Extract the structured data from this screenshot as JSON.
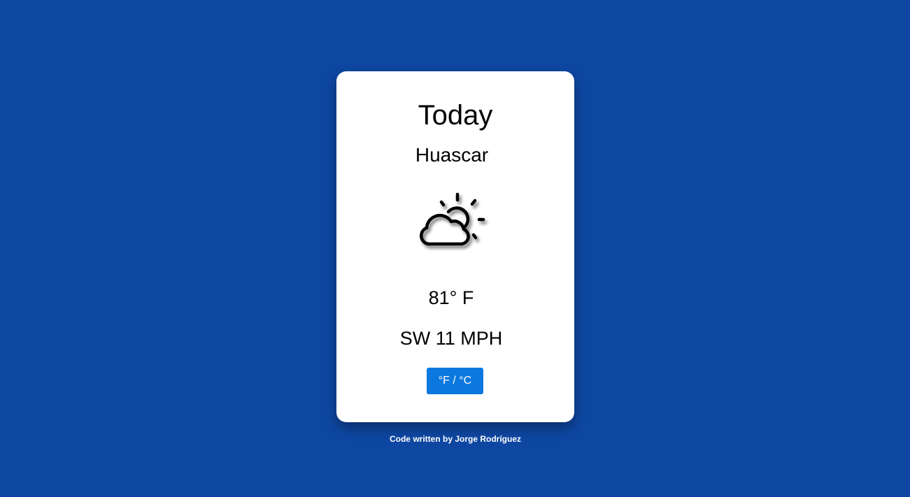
{
  "card": {
    "title": "Today",
    "location": "Huascar",
    "weather_icon": "partly-cloudy-icon",
    "temperature": "81° F",
    "wind": "SW 11 MPH",
    "toggle_label": "°F / °C"
  },
  "footer": {
    "credit": "Code written by Jorge Rodríguez"
  },
  "colors": {
    "background": "#0e47a2",
    "card": "#ffffff",
    "button": "#0c78df"
  }
}
